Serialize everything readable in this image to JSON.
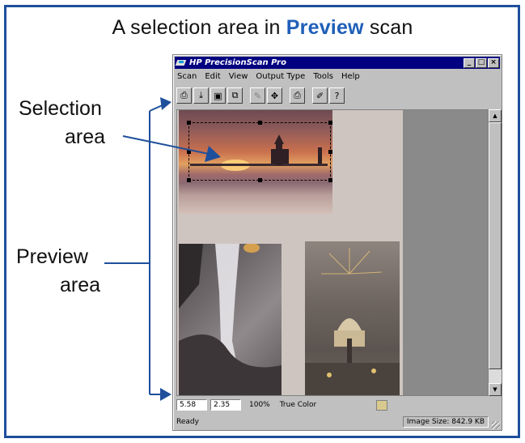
{
  "heading": {
    "prefix": "A selection area in ",
    "highlight": "Preview",
    "suffix": " scan"
  },
  "callouts": {
    "selection_line1": "Selection",
    "selection_line2": "area",
    "preview_line1": "Preview",
    "preview_line2": "area"
  },
  "window": {
    "title": "HP PrecisionScan Pro",
    "controls": [
      "_",
      "□",
      "×"
    ],
    "menu": [
      "Scan",
      "Edit",
      "View",
      "Output Type",
      "Tools",
      "Help"
    ],
    "toolbar_icons": [
      "scan-icon",
      "import-icon",
      "save-icon",
      "copy-icon",
      "open-icon",
      "move-icon",
      "print-icon",
      "help-scan-icon",
      "whats-this-icon"
    ],
    "coord_x": "5.58",
    "coord_y": "2.35",
    "zoom": "100%",
    "output_type": "True Color",
    "status": "Ready",
    "image_size": "Image Size: 842.9 KB"
  },
  "colors": {
    "accent": "#1e4f9c",
    "highlight": "#1f5fb8",
    "titlebar": "#000080",
    "window_face": "#c0c0c0"
  }
}
